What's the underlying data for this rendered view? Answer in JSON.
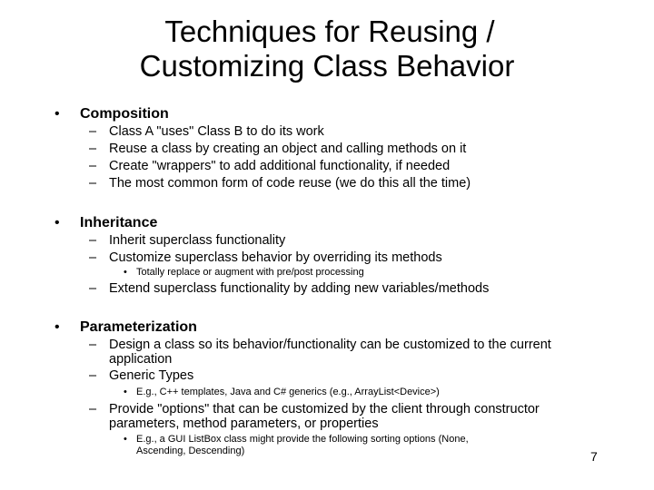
{
  "slide": {
    "title_line1": "Techniques for Reusing /",
    "title_line2": "Customizing Class Behavior",
    "page_number": "7"
  },
  "glyphs": {
    "bullet": "•",
    "dash": "–",
    "small_bullet": "•"
  },
  "sections": [
    {
      "heading": "Composition",
      "items": [
        {
          "text": "Class A \"uses\" Class B to do its work"
        },
        {
          "text": "Reuse a class by creating an object and calling methods on it"
        },
        {
          "text": "Create \"wrappers\" to add additional functionality, if needed"
        },
        {
          "text": "The most common form of code reuse (we do this all the time)"
        }
      ]
    },
    {
      "heading": "Inheritance",
      "items": [
        {
          "text": "Inherit superclass functionality"
        },
        {
          "text": "Customize superclass behavior by overriding its methods",
          "subitems": [
            "Totally replace or augment with pre/post processing"
          ]
        },
        {
          "text": "Extend superclass functionality by adding new variables/methods"
        }
      ]
    },
    {
      "heading": "Parameterization",
      "items": [
        {
          "text_line1": "Design a class so its behavior/functionality can be customized to the current",
          "text_line2": "application"
        },
        {
          "text": "Generic Types",
          "subitems": [
            "E.g., C++ templates, Java and C# generics (e.g., ArrayList<Device>)"
          ]
        },
        {
          "text_line1": "Provide \"options\" that can be customized by the client through constructor",
          "text_line2": "parameters, method parameters, or properties",
          "subitems_lines": [
            "E.g., a GUI ListBox class might provide the following sorting options (None,",
            "Ascending, Descending)"
          ]
        }
      ]
    }
  ]
}
